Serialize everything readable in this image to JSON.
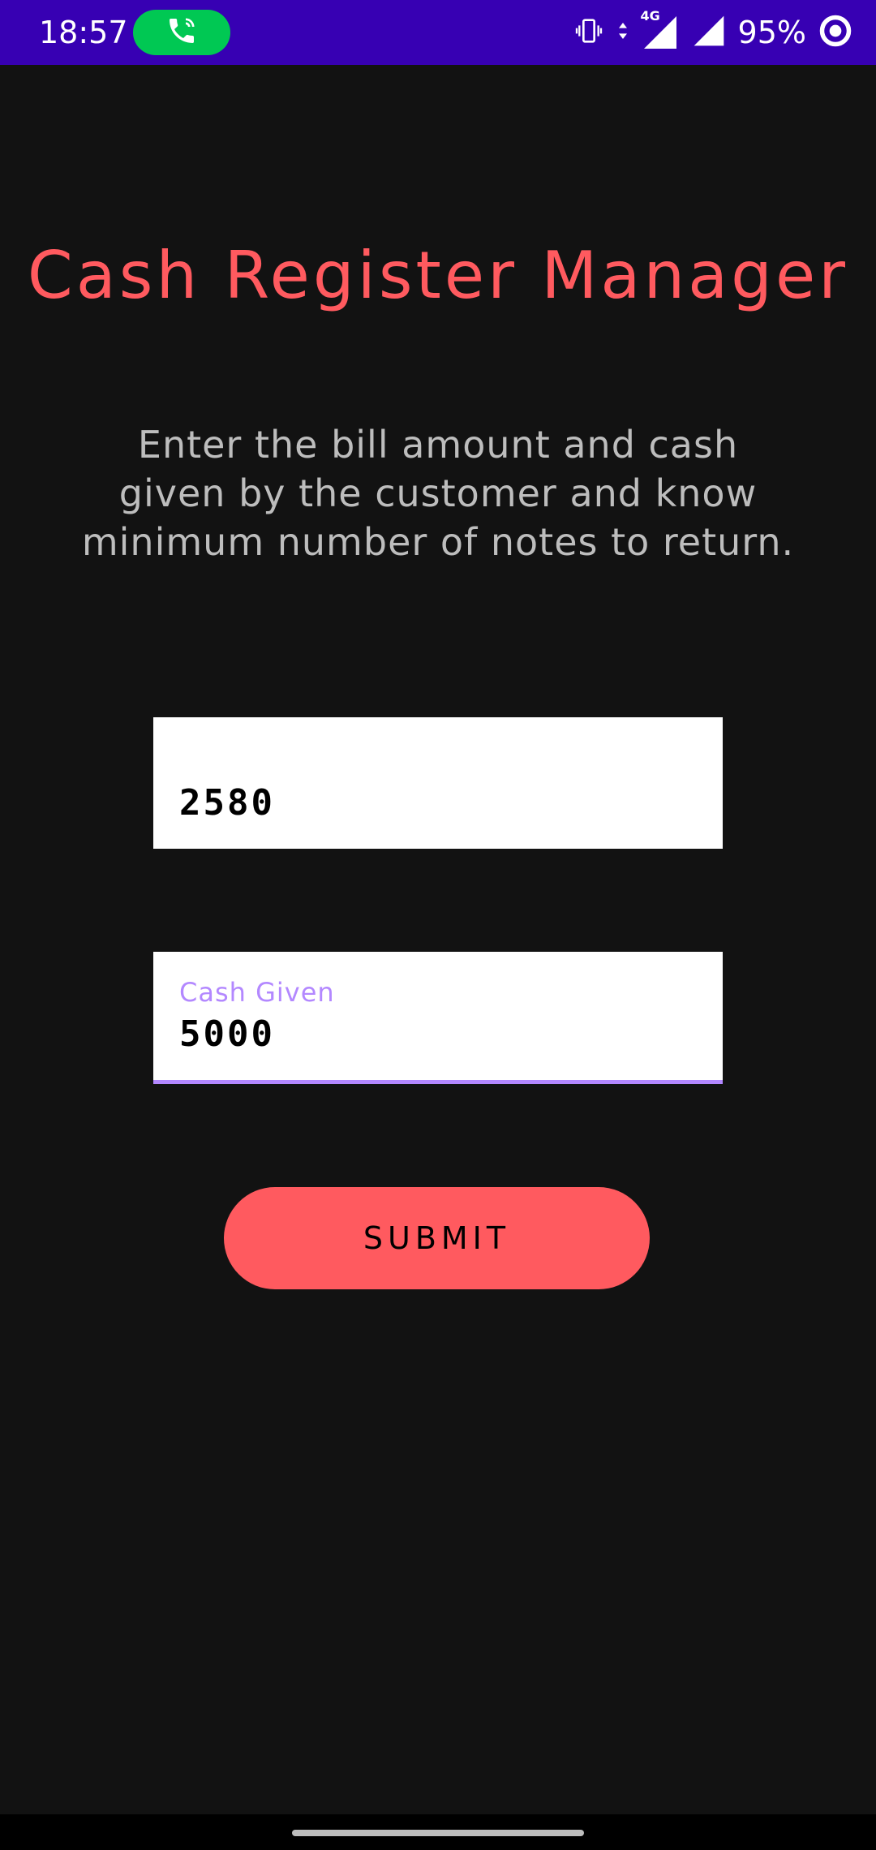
{
  "status_bar": {
    "time": "18:57",
    "call_icon": "phone-call-icon",
    "vibrate_icon": "vibrate-icon",
    "network_type": "4G",
    "battery": "95%",
    "colors": {
      "background": "#3700b3",
      "call_pill": "#00c853"
    }
  },
  "app": {
    "title": "Cash Register Manager",
    "description": "Enter the bill amount and cash given by the customer and know minimum number of notes to return.",
    "bill_field": {
      "value": "2580"
    },
    "cash_field": {
      "label": "Cash Given",
      "value": "5000"
    },
    "submit_label": "SUBMIT",
    "colors": {
      "accent": "#ff5a5f",
      "label": "#b388ff",
      "background": "#121212"
    }
  }
}
